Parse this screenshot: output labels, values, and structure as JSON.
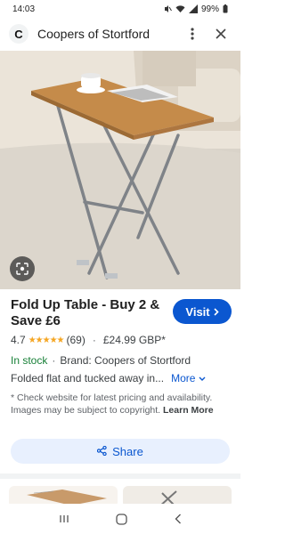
{
  "status_bar": {
    "time": "14:03",
    "battery": "99%"
  },
  "top_bar": {
    "logo_letter": "C",
    "title": "Coopers of Stortford"
  },
  "product": {
    "title": "Fold Up Table - Buy 2 & Save £6",
    "visit_label": "Visit",
    "rating": "4.7",
    "stars": "★★★★★",
    "review_count": "(69)",
    "separator": "·",
    "price": "£24.99 GBP*",
    "stock": "In stock",
    "brand": "Brand: Coopers of Stortford",
    "description": "Folded flat and tucked away in...",
    "more_label": "More",
    "disclaimer": "* Check website for latest pricing and availability. Images may be subject to copyright.",
    "learn_more": "Learn More"
  },
  "share_label": "Share",
  "colors": {
    "accent": "#0b57d0",
    "stock_green": "#188038",
    "star": "#f5a623"
  }
}
